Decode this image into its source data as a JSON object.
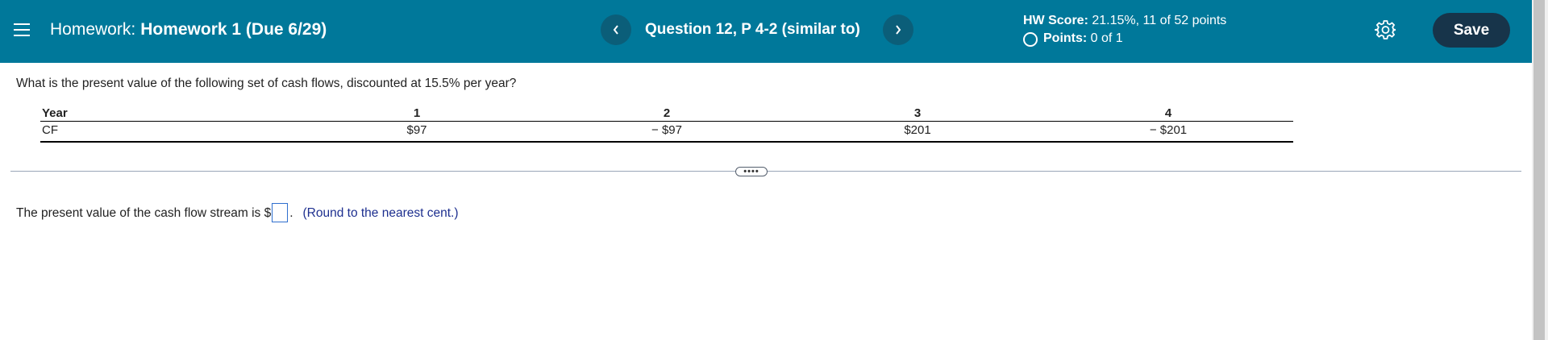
{
  "header": {
    "section_label": "Homework:",
    "assignment_name": "Homework 1 (Due 6/29)",
    "question_title": "Question 12, P 4-2 (similar to)",
    "prev_icon": "chevron-left-icon",
    "next_icon": "chevron-right-icon",
    "hw_score_label": "HW Score:",
    "hw_score_value": "21.15%, 11 of 52 points",
    "points_label": "Points:",
    "points_value": "0 of 1",
    "save_label": "Save",
    "settings_icon": "gear-icon",
    "menu_icon": "hamburger-menu-icon",
    "accent_color": "#00789a",
    "save_color": "#17344a"
  },
  "question": {
    "prompt": "What is the present value of the following set of cash flows, discounted at 15.5% per year?",
    "table": {
      "header_label": "Year",
      "row_label": "CF",
      "years": [
        "1",
        "2",
        "3",
        "4"
      ],
      "cash_flows": [
        "$97",
        "− $97",
        "$201",
        "− $201"
      ]
    },
    "expand_label": "••••",
    "answer_prefix": "The present value of the cash flow stream is $",
    "answer_value": "",
    "answer_suffix": ".",
    "round_hint": "(Round to the nearest cent.)"
  }
}
